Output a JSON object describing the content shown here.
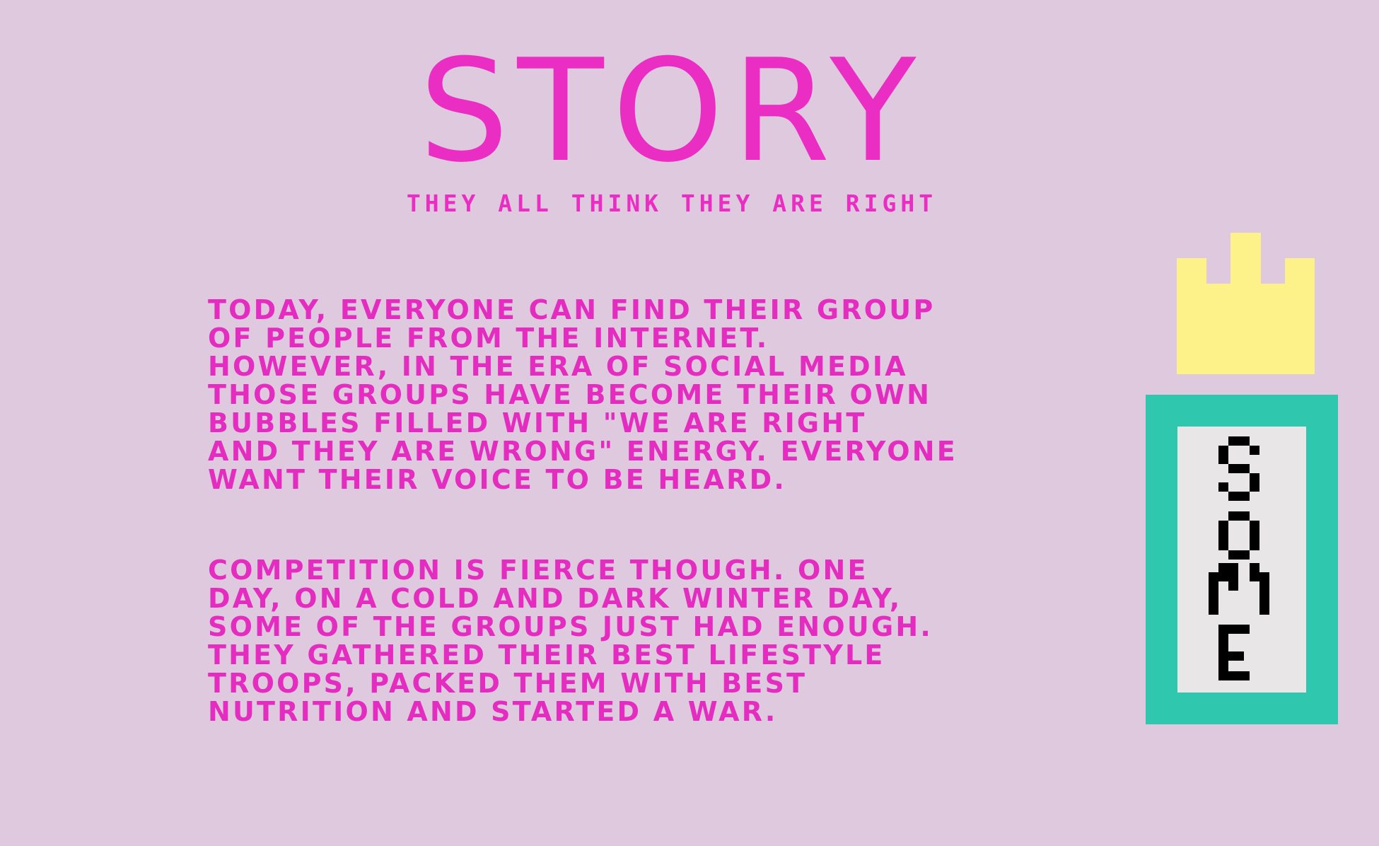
{
  "title": "STORY",
  "subtitle": "THEY ALL THINK THEY ARE RIGHT",
  "paragraphs": [
    "TODAY, EVERYONE CAN FIND THEIR GROUP\nOF PEOPLE FROM THE INTERNET.\nHOWEVER, IN THE ERA OF SOCIAL MEDIA\nTHOSE GROUPS HAVE BECOME THEIR OWN\nBUBBLES FILLED WITH \"WE ARE RIGHT\nAND THEY ARE WRONG\" ENERGY. EVERYONE\nWANT THEIR VOICE TO BE HEARD.",
    "COMPETITION IS FIERCE THOUGH. ONE\nDAY, ON A COLD AND DARK WINTER DAY,\nSOME OF THE GROUPS JUST HAD ENOUGH.\nTHEY GATHERED THEIR BEST LIFESTYLE\nTROOPS, PACKED THEM WITH BEST\nNUTRITION AND STARTED A WAR."
  ],
  "emblem": {
    "word": "SOME",
    "icon": "pixel-crown-icon"
  },
  "colors": {
    "background": "#dec9df",
    "accent": "#eb2ec3",
    "crown": "#fdf28a",
    "frame": "#2fc7ad",
    "panel": "#e8e6e7",
    "pixel": "#000000"
  }
}
